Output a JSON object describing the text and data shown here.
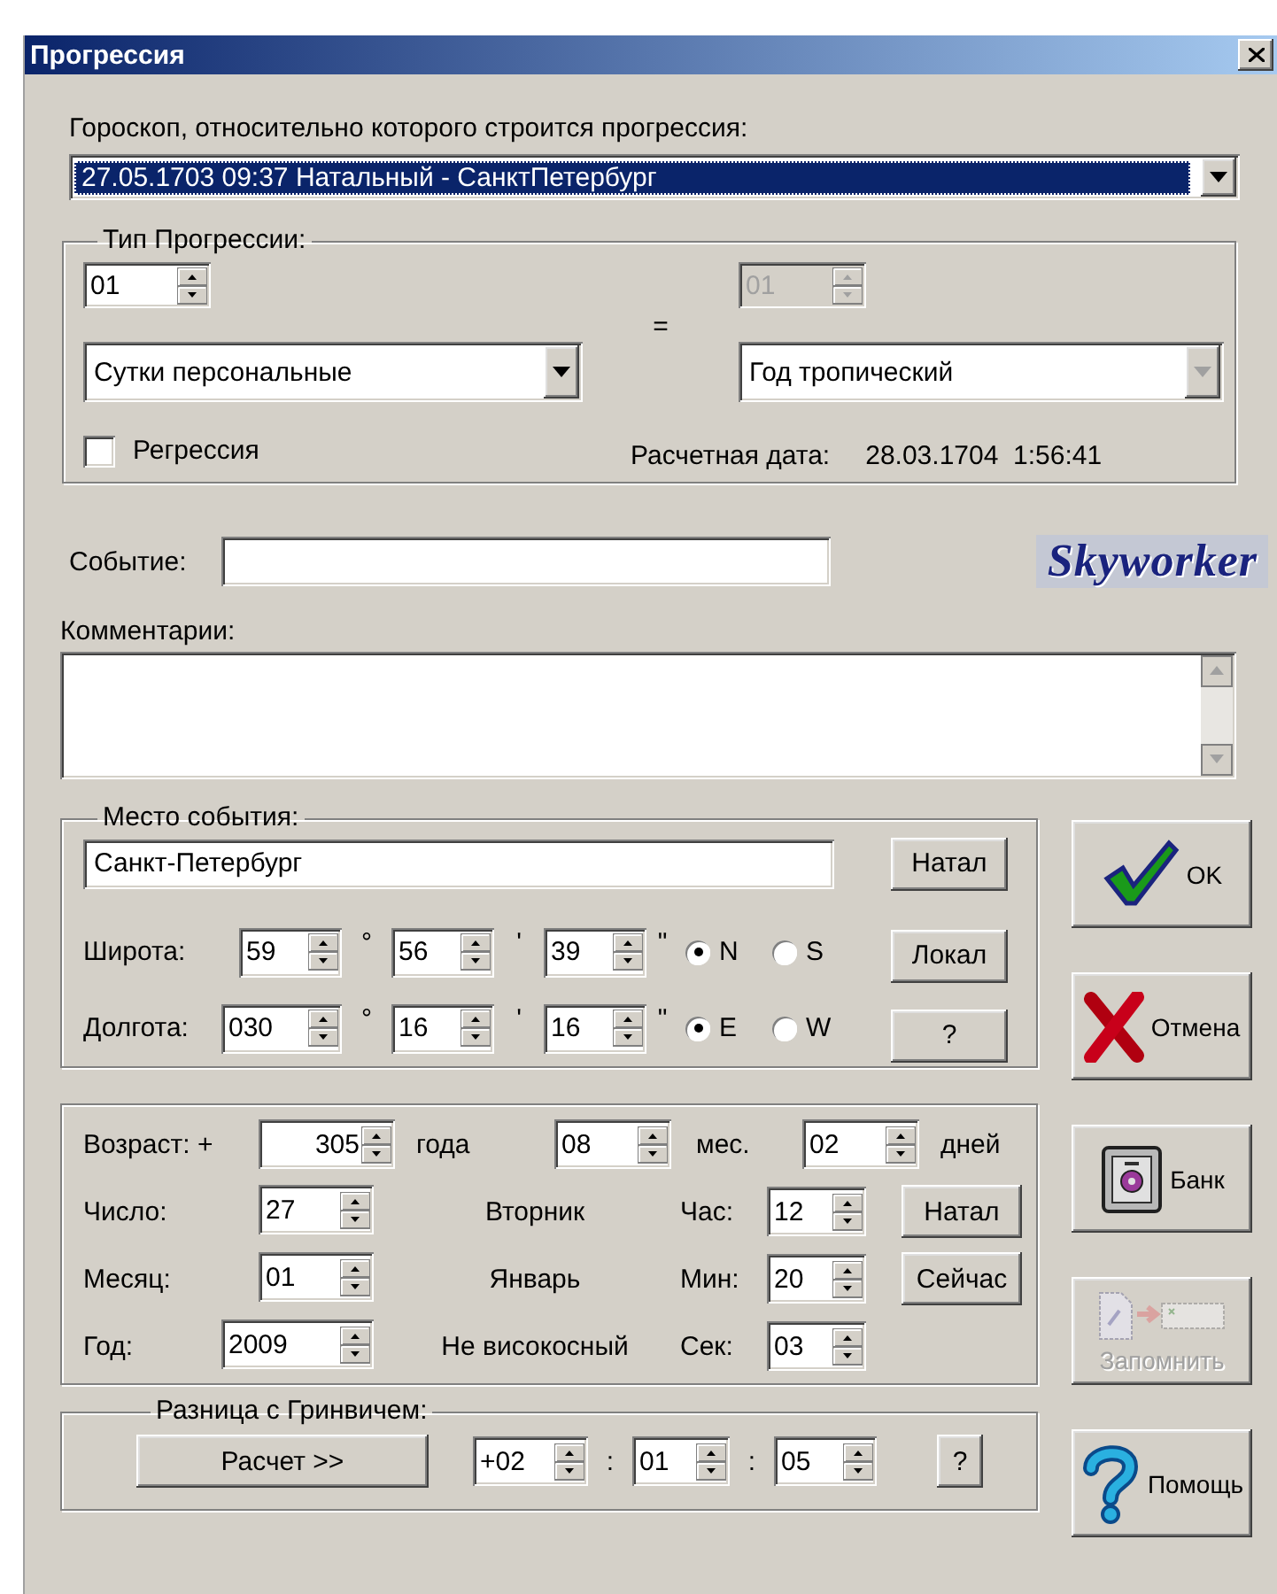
{
  "window": {
    "title": "Прогрессия"
  },
  "horoscope": {
    "label": "Гороскоп, относительно которого строится прогрессия:",
    "value": "27.05.1703 09:37 Натальный - СанктПетербург",
    "highlighted": true
  },
  "progression_type": {
    "title": "Тип Прогрессии:",
    "left_count": {
      "value": "01",
      "disabled": false
    },
    "left_unit": {
      "value": "Сутки персональные",
      "disabled": false
    },
    "equals": "=",
    "right_count": {
      "value": "01",
      "disabled": true
    },
    "right_unit": {
      "value": "Год тропический",
      "disabled": true
    },
    "regression": {
      "label": "Регрессия",
      "checked": false
    },
    "calc_date_label": "Расчетная дата:",
    "calc_date": "28.03.1704  1:56:41"
  },
  "event": {
    "label": "Событие:"
  },
  "logo": "Skyworker",
  "comments": {
    "label": "Комментарии:"
  },
  "place": {
    "title": "Место события:",
    "city": "Санкт-Петербург",
    "rows": [
      {
        "label": "Широта:",
        "degrees": "59",
        "minutes": "56",
        "seconds": "39",
        "units": [
          "°",
          "'",
          "\""
        ],
        "hemispheres": [
          {
            "label": "N",
            "selected": true
          },
          {
            "label": "S",
            "selected": false
          }
        ]
      },
      {
        "label": "Долгота:",
        "degrees": "030",
        "minutes": "16",
        "seconds": "16",
        "units": [
          "°",
          "'",
          "\""
        ],
        "hemispheres": [
          {
            "label": "E",
            "selected": true
          },
          {
            "label": "W",
            "selected": false
          }
        ]
      }
    ],
    "buttons": [
      "Натал",
      "Локал",
      "?"
    ]
  },
  "age": {
    "label": "Возраст: +",
    "years": "305",
    "years_unit": "года",
    "months": "08",
    "months_unit": "мес.",
    "days": "02",
    "days_unit": "дней"
  },
  "date_rows": [
    {
      "label": "Число:",
      "value": "27",
      "info": "Вторник",
      "time_label": "Час:",
      "time_value": "12",
      "button": "Натал"
    },
    {
      "label": "Месяц:",
      "value": "01",
      "info": "Январь",
      "time_label": "Мин:",
      "time_value": "20",
      "button": "Сейчас"
    },
    {
      "label": "Год:",
      "value": "2009",
      "info": "Не високосный",
      "time_label": "Сек:",
      "time_value": "03"
    }
  ],
  "gmt": {
    "title": "Разница с Гринвичем:",
    "calc_button": "Расчет >>",
    "hours": "+02",
    "minutes": "01",
    "seconds": "05",
    "separators": [
      ":",
      ":"
    ],
    "help": "?"
  },
  "side_buttons": [
    {
      "kind": "ok",
      "label": "OK",
      "disabled": false
    },
    {
      "kind": "cancel",
      "label": "Отмена",
      "disabled": false
    },
    {
      "kind": "bank",
      "label": "Банк",
      "disabled": false
    },
    {
      "kind": "remember",
      "label": "Запомнить",
      "disabled": true
    },
    {
      "kind": "help",
      "label": "Помощь",
      "disabled": false
    }
  ]
}
